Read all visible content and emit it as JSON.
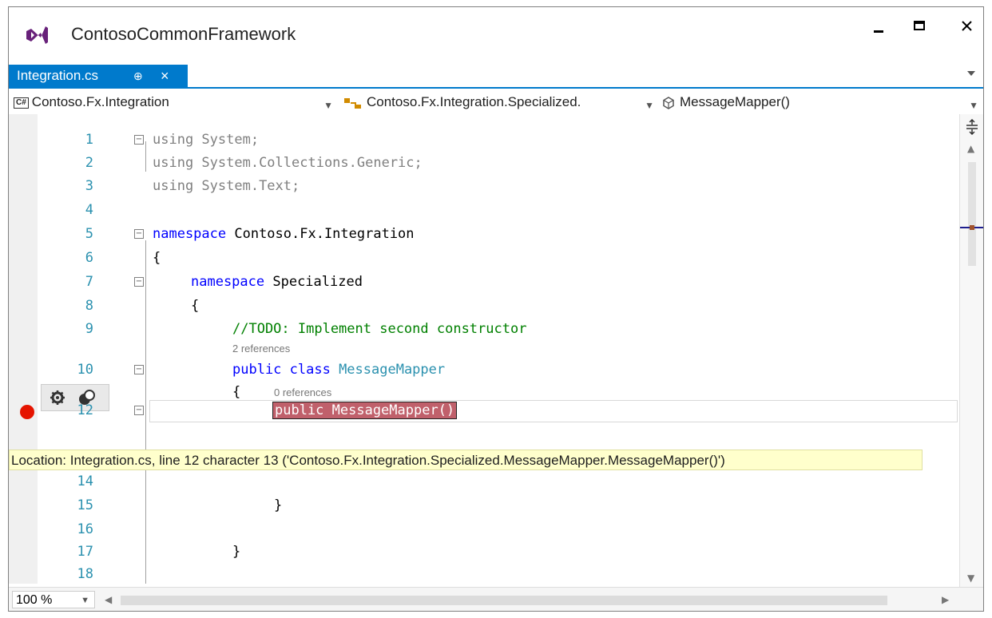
{
  "window": {
    "title": "ContosoCommonFramework",
    "controls": {
      "minimize": "▬",
      "maximize": "■",
      "close": "×"
    }
  },
  "tab": {
    "label": "Integration.cs",
    "pin": "⊕",
    "close": "×"
  },
  "navbar": {
    "project": "Contoso.Fx.Integration",
    "type": "Contoso.Fx.Integration.Specialized.",
    "member": "MessageMapper()"
  },
  "editor": {
    "line_numbers": [
      "1",
      "2",
      "3",
      "4",
      "5",
      "6",
      "7",
      "8",
      "9",
      "10",
      "12",
      "14",
      "15",
      "16",
      "17",
      "18"
    ],
    "references": {
      "class": "2 references",
      "ctor": "0 references"
    },
    "code": {
      "l1_kw": "using",
      "l1_rest": " System;",
      "l2_kw": "using",
      "l2_rest": " System.Collections.Generic;",
      "l3_kw": "using",
      "l3_rest": " System.Text;",
      "l5_kw": "namespace",
      "l5_rest": " Contoso.Fx.Integration",
      "l6": "{",
      "l7_kw": "namespace",
      "l7_rest": " Specialized",
      "l8": "{",
      "l9": "//TODO: Implement second constructor",
      "l10_kw": "public class",
      "l10_type": " MessageMapper",
      "l11": "{",
      "l12": "public MessageMapper()",
      "l15": "}",
      "l17": "}"
    },
    "tooltip": "Location: Integration.cs, line 12 character 13 ('Contoso.Fx.Integration.Specialized.MessageMapper.MessageMapper()')"
  },
  "statusbar": {
    "zoom": "100 %"
  },
  "colors": {
    "accent": "#007acc",
    "breakpoint": "#e51400",
    "tooltip_bg": "#ffffcc"
  }
}
